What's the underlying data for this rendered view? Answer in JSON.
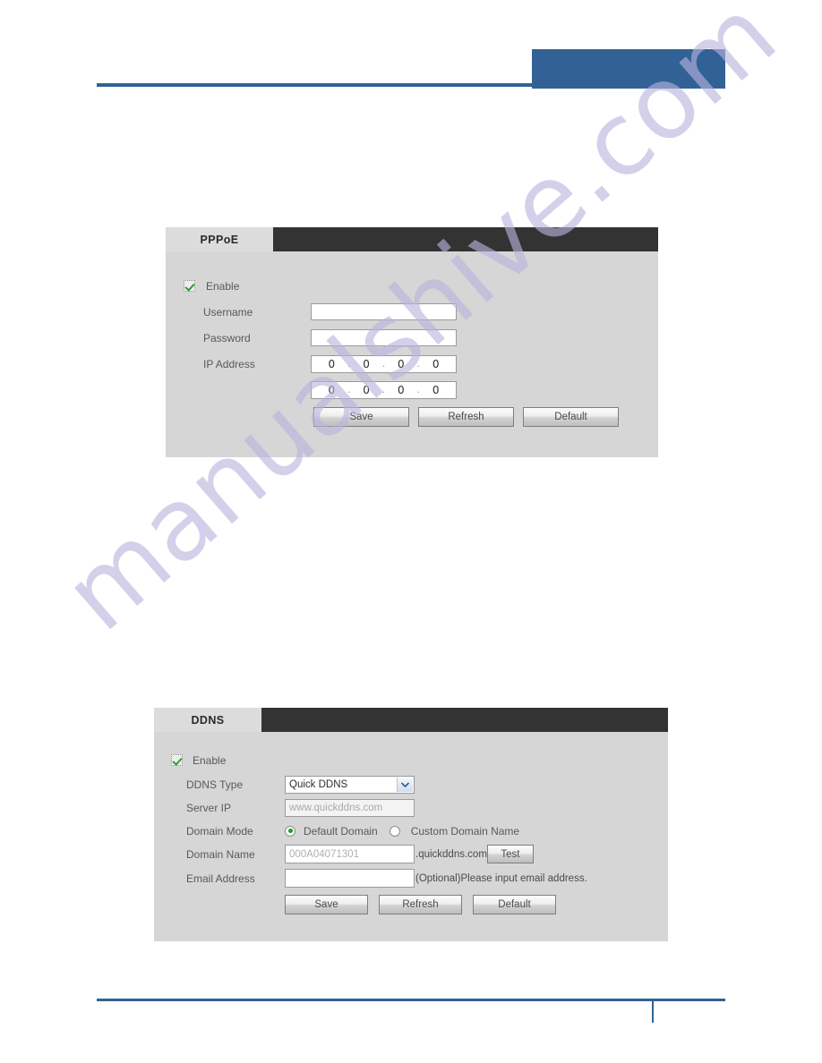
{
  "page": {
    "background_color": "#ffffff",
    "accent_color": "#326295",
    "watermark_text": "manualshive.com"
  },
  "header": {
    "rule_color": "#326295",
    "block_color": "#326295"
  },
  "footer": {
    "rule_color": "#326295"
  },
  "pppoe_panel": {
    "tab_label": "PPPoE",
    "enable": {
      "label": "Enable",
      "checked": true
    },
    "fields": [
      {
        "label": "Username",
        "value": "",
        "placeholder": ""
      },
      {
        "label": "Password",
        "value": "",
        "placeholder": ""
      },
      {
        "label": "IP Address",
        "value": "0 . 0 . 0 . 0"
      }
    ],
    "ip_primary": [
      "0",
      "0",
      "0",
      "0"
    ],
    "ip_secondary": [
      "0",
      "0",
      "0",
      "0"
    ],
    "buttons": [
      {
        "label": "Save"
      },
      {
        "label": "Refresh"
      },
      {
        "label": "Default"
      }
    ]
  },
  "ddns_panel": {
    "tab_label": "DDNS",
    "enable": {
      "label": "Enable",
      "checked": true
    },
    "ddns_type": {
      "label": "DDNS Type",
      "selected": "Quick DDNS",
      "options": [
        "Quick DDNS"
      ]
    },
    "server_ip": {
      "label": "Server IP",
      "value": "www.quickddns.com",
      "disabled": true
    },
    "domain_mode": {
      "label": "Domain Mode",
      "options": [
        {
          "label": "Default Domain",
          "selected": true
        },
        {
          "label": "Custom Domain Name",
          "selected": false
        }
      ]
    },
    "domain_name": {
      "label": "Domain Name",
      "value": "000A04071301",
      "suffix": ".quickddns.com",
      "test_button": "Test"
    },
    "email_address": {
      "label": "Email Address",
      "value": "",
      "hint": "(Optional)Please input email address."
    },
    "buttons": [
      {
        "label": "Save"
      },
      {
        "label": "Refresh"
      },
      {
        "label": "Default"
      }
    ]
  }
}
